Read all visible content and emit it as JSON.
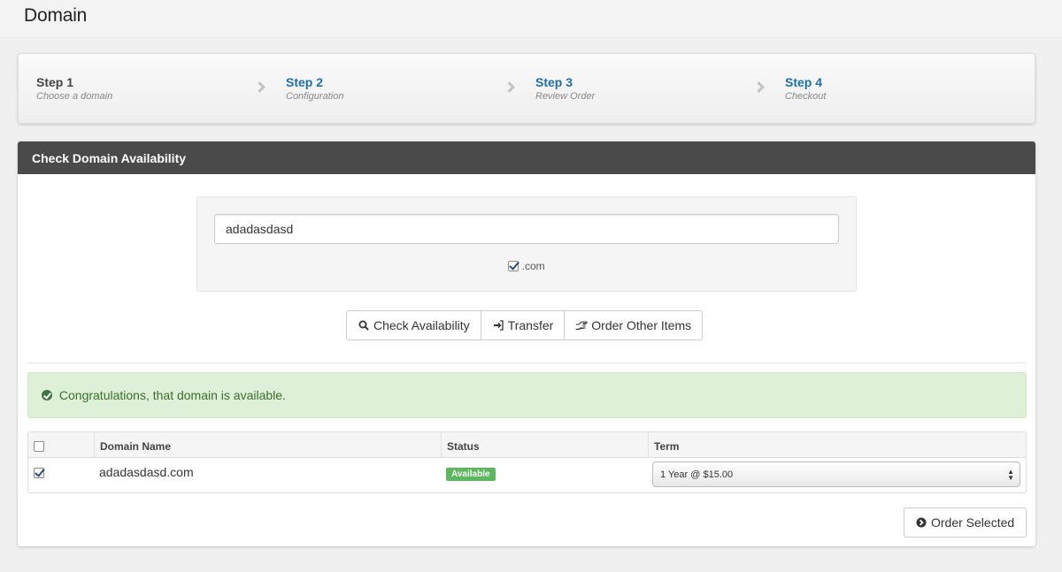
{
  "page": {
    "title": "Domain"
  },
  "steps": [
    {
      "title": "Step 1",
      "sub": "Choose a domain"
    },
    {
      "title": "Step 2",
      "sub": "Configuration"
    },
    {
      "title": "Step 3",
      "sub": "Review Order"
    },
    {
      "title": "Step 4",
      "sub": "Checkout"
    }
  ],
  "panel": {
    "heading": "Check Domain Availability"
  },
  "search": {
    "value": "adadasdasd",
    "tld_label": ".com",
    "tld_checked": true
  },
  "buttons": {
    "check": "Check Availability",
    "transfer": "Transfer",
    "other": "Order Other Items",
    "order_selected": "Order Selected"
  },
  "alert": {
    "text": "Congratulations, that domain is available."
  },
  "table": {
    "headers": {
      "domain": "Domain Name",
      "status": "Status",
      "term": "Term"
    },
    "rows": [
      {
        "checked": true,
        "domain": "adadasdasd.com",
        "status": "Available",
        "term": "1 Year @ $15.00"
      }
    ]
  },
  "colors": {
    "accent": "#1e6fa8",
    "success": "#5cb85c",
    "header_bar": "#4a4a4a",
    "alert_bg": "#dff0d8"
  },
  "icons": [
    "search-icon",
    "sign-in-icon",
    "hand-pointer-icon",
    "check-circle-icon",
    "arrow-circle-right-icon",
    "chevron-right-icon"
  ]
}
